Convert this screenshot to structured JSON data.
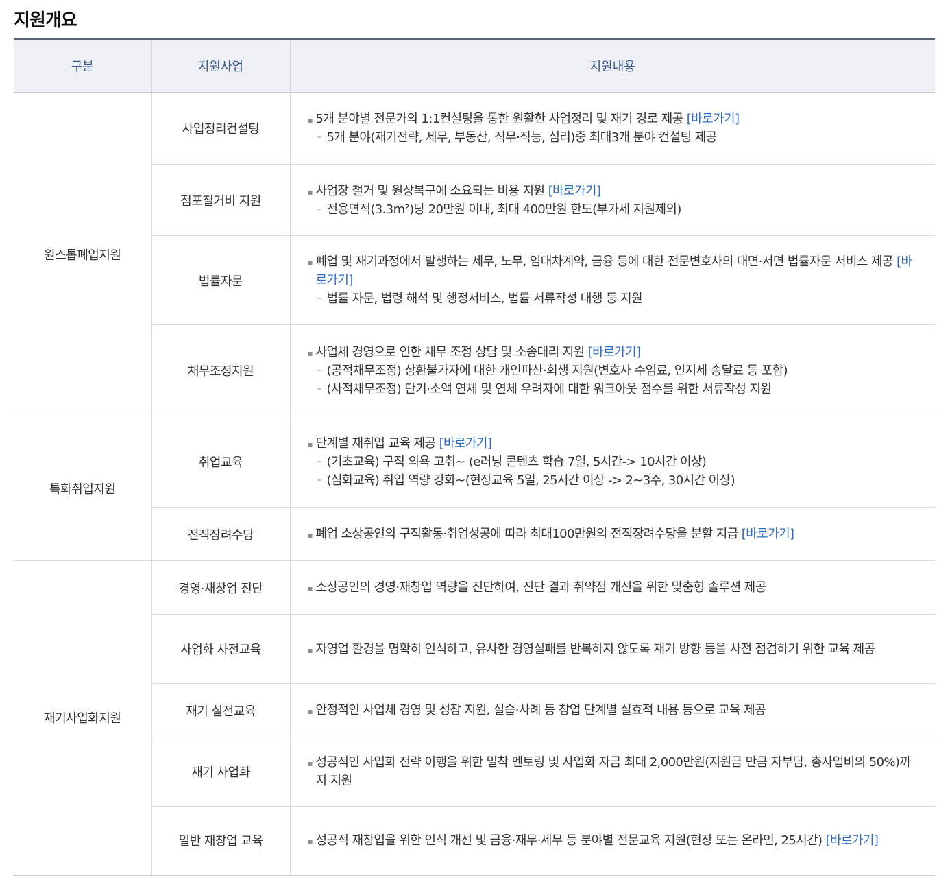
{
  "page_title": "지원개요",
  "headers": {
    "category": "구분",
    "program": "지원사업",
    "content": "지원내용"
  },
  "link_label": "[바로가기]",
  "groups": [
    {
      "category": "원스톱폐업지원",
      "rows": [
        {
          "program": "사업정리컨설팅",
          "main": "5개 분야별 전문가의 1:1컨설팅을 통한 원활한 사업정리 및 재기 경로 제공",
          "subs": [
            "5개 분야(재기전략, 세무, 부동산, 직무·직능, 심리)중 최대3개 분야 컨설팅 제공"
          ]
        },
        {
          "program": "점포철거비 지원",
          "main": "사업장 철거 및 원상복구에 소요되는 비용 지원",
          "subs": [
            "전용면적(3.3m²)당 20만원 이내, 최대 400만원 한도(부가세 지원제외)"
          ]
        },
        {
          "program": "법률자문",
          "main": "폐업 및 재기과정에서 발생하는 세무, 노무, 임대차계약, 금융 등에 대한 전문변호사의 대면·서면 법률자문 서비스 제공",
          "subs": [
            "법률 자문, 법령 해석 및 행정서비스, 법률 서류작성 대행 등 지원"
          ]
        },
        {
          "program": "채무조정지원",
          "main": "사업체 경영으로 인한 채무 조정 상담 및 소송대리 지원",
          "subs": [
            "(공적채무조정) 상환불가자에 대한 개인파산·회생 지원(변호사 수임료, 인지세 송달료 등 포함)",
            "(사적채무조정) 단기·소액 연체 및 연체 우려자에 대한 워크아웃 점수를 위한 서류작성 지원"
          ]
        }
      ]
    },
    {
      "category": "특화취업지원",
      "rows": [
        {
          "program": "취업교육",
          "main": "단계별 재취업 교육 제공",
          "subs": [
            "(기초교육) 구직 의욕 고취~ (e러닝 콘텐츠 학습 7일, 5시간-> 10시간 이상)",
            "(심화교육) 취업 역량 강화~(현장교육 5일, 25시간 이상 -> 2~3주, 30시간 이상)"
          ]
        },
        {
          "program": "전직장려수당",
          "main": "폐업 소상공인의 구직활동·취업성공에 따라 최대100만원의 전직장려수당을 분할 지급",
          "subs": []
        }
      ]
    },
    {
      "category": "재기사업화지원",
      "rows": [
        {
          "program": "경영·재창업 진단",
          "main": "소상공인의 경영·재창업 역량을 진단하여, 진단 결과 취약점 개선을 위한 맞춤형 솔루션 제공",
          "subs": []
        },
        {
          "program": "사업화 사전교육",
          "main": "자영업 환경을 명확히 인식하고, 유사한 경영실패를 반복하지 않도록 재기 방향 등을 사전 점검하기 위한 교육 제공",
          "subs": []
        },
        {
          "program": "재기 실전교육",
          "main": "안정적인 사업체 경영 및 성장 지원, 실습·사례 등 창업 단계별 실효적 내용 등으로 교육 제공",
          "subs": []
        },
        {
          "program": "재기 사업화",
          "main": "성공적인 사업화 전략 이행을 위한 밀착 멘토링 및 사업화 자금 최대 2,000만원(지원금 만큼 자부담, 총사업비의 50%)까지 지원",
          "subs": []
        },
        {
          "program": "일반 재창업 교육",
          "main": "성공적 재창업을 위한 인식 개선 및 금융·재무·세무 등 분야별 전문교육 지원(현장 또는 온라인, 25시간)",
          "subs": []
        }
      ]
    }
  ]
}
